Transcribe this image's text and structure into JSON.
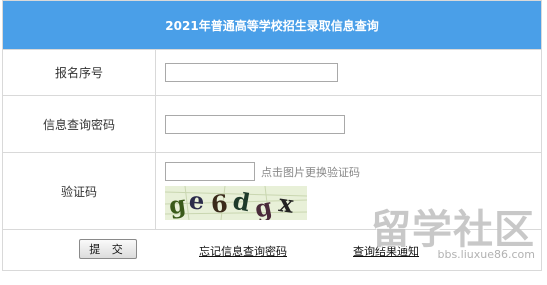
{
  "title": "2021年普通高等学校招生录取信息查询",
  "fields": {
    "id_label": "报名序号",
    "id_value": "",
    "password_label": "信息查询密码",
    "password_value": "",
    "code_label": "验证码",
    "code_value": "",
    "code_refresh_hint": "点击图片更换验证码"
  },
  "captcha": {
    "chars": [
      "g",
      "e",
      "6",
      "d",
      "g",
      "x"
    ],
    "background_color": "#e8f0d8"
  },
  "actions": {
    "submit_label": "提 交",
    "forgot_link": "忘记信息查询密码",
    "query_link": "查询结果通知"
  },
  "watermark": {
    "main": "留学社区",
    "sub": "bbs.liuxue86.com"
  },
  "colors": {
    "header_bg": "#4a9fe8",
    "header_text": "#ffffff"
  }
}
